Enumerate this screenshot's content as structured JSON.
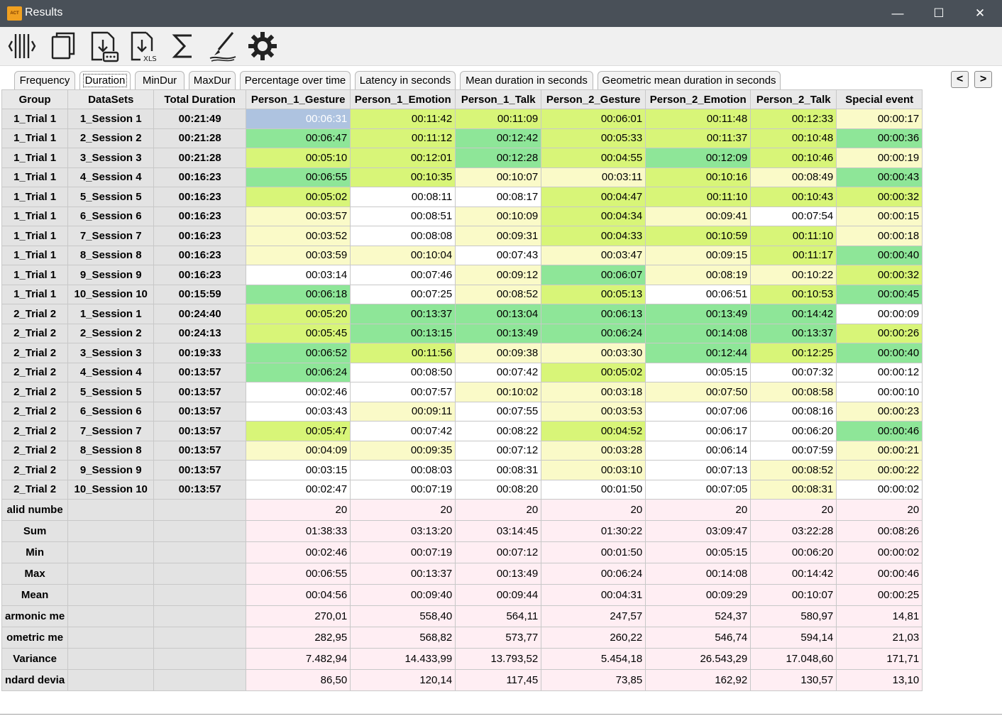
{
  "window": {
    "title": "Results",
    "app_icon_text": "ACT",
    "minimize_glyph": "—",
    "maximize_glyph": "☐",
    "close_glyph": "✕"
  },
  "toolbar": {
    "buttons": [
      "columns-icon",
      "copy-icon",
      "export-text-icon",
      "export-xls-icon",
      "sum-icon",
      "brush-icon",
      "settings-icon"
    ],
    "xls_label": "XLS"
  },
  "tabs": [
    {
      "label": "Frequency"
    },
    {
      "label": "Duration"
    },
    {
      "label": "MinDur"
    },
    {
      "label": "MaxDur"
    },
    {
      "label": "Percentage over time"
    },
    {
      "label": "Latency in seconds"
    },
    {
      "label": "Mean duration in seconds"
    },
    {
      "label": "Geometric mean duration in seconds"
    }
  ],
  "active_tab": "Duration",
  "nav": {
    "prev": "<",
    "next": ">"
  },
  "columns": [
    "Group",
    "DataSets",
    "Total Duration",
    "Person_1_Gesture",
    "Person_1_Emotion",
    "Person_1_Talk",
    "Person_2_Gesture",
    "Person_2_Emotion",
    "Person_2_Talk",
    "Special event"
  ],
  "rows": [
    {
      "group": "1_Trial 1",
      "dataset": "1_Session 1",
      "total": "00:21:49",
      "values": [
        "00:06:31",
        "00:11:42",
        "00:11:09",
        "00:06:01",
        "00:11:48",
        "00:12:33",
        "00:00:17"
      ],
      "colors": [
        "sel",
        "lime",
        "lime",
        "lime",
        "lime",
        "lime",
        "yellow"
      ]
    },
    {
      "group": "1_Trial 1",
      "dataset": "2_Session 2",
      "total": "00:21:28",
      "values": [
        "00:06:47",
        "00:11:12",
        "00:12:42",
        "00:05:33",
        "00:11:37",
        "00:10:48",
        "00:00:36"
      ],
      "colors": [
        "green",
        "lime",
        "green",
        "lime",
        "lime",
        "lime",
        "green"
      ]
    },
    {
      "group": "1_Trial 1",
      "dataset": "3_Session 3",
      "total": "00:21:28",
      "values": [
        "00:05:10",
        "00:12:01",
        "00:12:28",
        "00:04:55",
        "00:12:09",
        "00:10:46",
        "00:00:19"
      ],
      "colors": [
        "lime",
        "lime",
        "green",
        "lime",
        "green",
        "lime",
        "yellow"
      ]
    },
    {
      "group": "1_Trial 1",
      "dataset": "4_Session 4",
      "total": "00:16:23",
      "values": [
        "00:06:55",
        "00:10:35",
        "00:10:07",
        "00:03:11",
        "00:10:16",
        "00:08:49",
        "00:00:43"
      ],
      "colors": [
        "green",
        "lime",
        "yellow",
        "yellow",
        "lime",
        "yellow",
        "green"
      ]
    },
    {
      "group": "1_Trial 1",
      "dataset": "5_Session 5",
      "total": "00:16:23",
      "values": [
        "00:05:02",
        "00:08:11",
        "00:08:17",
        "00:04:47",
        "00:11:10",
        "00:10:43",
        "00:00:32"
      ],
      "colors": [
        "lime",
        "white",
        "white",
        "lime",
        "lime",
        "lime",
        "lime"
      ]
    },
    {
      "group": "1_Trial 1",
      "dataset": "6_Session 6",
      "total": "00:16:23",
      "values": [
        "00:03:57",
        "00:08:51",
        "00:10:09",
        "00:04:34",
        "00:09:41",
        "00:07:54",
        "00:00:15"
      ],
      "colors": [
        "yellow",
        "white",
        "yellow",
        "lime",
        "yellow",
        "white",
        "yellow"
      ]
    },
    {
      "group": "1_Trial 1",
      "dataset": "7_Session 7",
      "total": "00:16:23",
      "values": [
        "00:03:52",
        "00:08:08",
        "00:09:31",
        "00:04:33",
        "00:10:59",
        "00:11:10",
        "00:00:18"
      ],
      "colors": [
        "yellow",
        "white",
        "yellow",
        "lime",
        "lime",
        "lime",
        "yellow"
      ]
    },
    {
      "group": "1_Trial 1",
      "dataset": "8_Session 8",
      "total": "00:16:23",
      "values": [
        "00:03:59",
        "00:10:04",
        "00:07:43",
        "00:03:47",
        "00:09:15",
        "00:11:17",
        "00:00:40"
      ],
      "colors": [
        "yellow",
        "yellow",
        "white",
        "yellow",
        "yellow",
        "lime",
        "green"
      ]
    },
    {
      "group": "1_Trial 1",
      "dataset": "9_Session 9",
      "total": "00:16:23",
      "values": [
        "00:03:14",
        "00:07:46",
        "00:09:12",
        "00:06:07",
        "00:08:19",
        "00:10:22",
        "00:00:32"
      ],
      "colors": [
        "white",
        "white",
        "yellow",
        "green",
        "yellow",
        "yellow",
        "lime"
      ]
    },
    {
      "group": "1_Trial 1",
      "dataset": "10_Session 10",
      "total": "00:15:59",
      "values": [
        "00:06:18",
        "00:07:25",
        "00:08:52",
        "00:05:13",
        "00:06:51",
        "00:10:53",
        "00:00:45"
      ],
      "colors": [
        "green",
        "white",
        "yellow",
        "lime",
        "white",
        "lime",
        "green"
      ]
    },
    {
      "group": "2_Trial 2",
      "dataset": "1_Session 1",
      "total": "00:24:40",
      "values": [
        "00:05:20",
        "00:13:37",
        "00:13:04",
        "00:06:13",
        "00:13:49",
        "00:14:42",
        "00:00:09"
      ],
      "colors": [
        "lime",
        "green",
        "green",
        "green",
        "green",
        "green",
        "white"
      ]
    },
    {
      "group": "2_Trial 2",
      "dataset": "2_Session 2",
      "total": "00:24:13",
      "values": [
        "00:05:45",
        "00:13:15",
        "00:13:49",
        "00:06:24",
        "00:14:08",
        "00:13:37",
        "00:00:26"
      ],
      "colors": [
        "lime",
        "green",
        "green",
        "green",
        "green",
        "green",
        "lime"
      ]
    },
    {
      "group": "2_Trial 2",
      "dataset": "3_Session 3",
      "total": "00:19:33",
      "values": [
        "00:06:52",
        "00:11:56",
        "00:09:38",
        "00:03:30",
        "00:12:44",
        "00:12:25",
        "00:00:40"
      ],
      "colors": [
        "green",
        "lime",
        "yellow",
        "yellow",
        "green",
        "lime",
        "green"
      ]
    },
    {
      "group": "2_Trial 2",
      "dataset": "4_Session 4",
      "total": "00:13:57",
      "values": [
        "00:06:24",
        "00:08:50",
        "00:07:42",
        "00:05:02",
        "00:05:15",
        "00:07:32",
        "00:00:12"
      ],
      "colors": [
        "green",
        "white",
        "white",
        "lime",
        "white",
        "white",
        "white"
      ]
    },
    {
      "group": "2_Trial 2",
      "dataset": "5_Session 5",
      "total": "00:13:57",
      "values": [
        "00:02:46",
        "00:07:57",
        "00:10:02",
        "00:03:18",
        "00:07:50",
        "00:08:58",
        "00:00:10"
      ],
      "colors": [
        "white",
        "white",
        "yellow",
        "yellow",
        "yellow",
        "yellow",
        "white"
      ]
    },
    {
      "group": "2_Trial 2",
      "dataset": "6_Session 6",
      "total": "00:13:57",
      "values": [
        "00:03:43",
        "00:09:11",
        "00:07:55",
        "00:03:53",
        "00:07:06",
        "00:08:16",
        "00:00:23"
      ],
      "colors": [
        "white",
        "yellow",
        "white",
        "yellow",
        "white",
        "white",
        "yellow"
      ]
    },
    {
      "group": "2_Trial 2",
      "dataset": "7_Session 7",
      "total": "00:13:57",
      "values": [
        "00:05:47",
        "00:07:42",
        "00:08:22",
        "00:04:52",
        "00:06:17",
        "00:06:20",
        "00:00:46"
      ],
      "colors": [
        "lime",
        "white",
        "white",
        "lime",
        "white",
        "white",
        "green"
      ]
    },
    {
      "group": "2_Trial 2",
      "dataset": "8_Session 8",
      "total": "00:13:57",
      "values": [
        "00:04:09",
        "00:09:35",
        "00:07:12",
        "00:03:28",
        "00:06:14",
        "00:07:59",
        "00:00:21"
      ],
      "colors": [
        "yellow",
        "yellow",
        "white",
        "yellow",
        "white",
        "white",
        "yellow"
      ]
    },
    {
      "group": "2_Trial 2",
      "dataset": "9_Session 9",
      "total": "00:13:57",
      "values": [
        "00:03:15",
        "00:08:03",
        "00:08:31",
        "00:03:10",
        "00:07:13",
        "00:08:52",
        "00:00:22"
      ],
      "colors": [
        "white",
        "white",
        "white",
        "yellow",
        "white",
        "yellow",
        "yellow"
      ]
    },
    {
      "group": "2_Trial 2",
      "dataset": "10_Session 10",
      "total": "00:13:57",
      "values": [
        "00:02:47",
        "00:07:19",
        "00:08:20",
        "00:01:50",
        "00:07:05",
        "00:08:31",
        "00:00:02"
      ],
      "colors": [
        "white",
        "white",
        "white",
        "white",
        "white",
        "yellow",
        "white"
      ]
    }
  ],
  "stats": [
    {
      "label": "alid numbe",
      "values": [
        "20",
        "20",
        "20",
        "20",
        "20",
        "20",
        "20"
      ]
    },
    {
      "label": "Sum",
      "values": [
        "01:38:33",
        "03:13:20",
        "03:14:45",
        "01:30:22",
        "03:09:47",
        "03:22:28",
        "00:08:26"
      ]
    },
    {
      "label": "Min",
      "values": [
        "00:02:46",
        "00:07:19",
        "00:07:12",
        "00:01:50",
        "00:05:15",
        "00:06:20",
        "00:00:02"
      ]
    },
    {
      "label": "Max",
      "values": [
        "00:06:55",
        "00:13:37",
        "00:13:49",
        "00:06:24",
        "00:14:08",
        "00:14:42",
        "00:00:46"
      ]
    },
    {
      "label": "Mean",
      "values": [
        "00:04:56",
        "00:09:40",
        "00:09:44",
        "00:04:31",
        "00:09:29",
        "00:10:07",
        "00:00:25"
      ]
    },
    {
      "label": "armonic me",
      "values": [
        "270,01",
        "558,40",
        "564,11",
        "247,57",
        "524,37",
        "580,97",
        "14,81"
      ]
    },
    {
      "label": "ometric me",
      "values": [
        "282,95",
        "568,82",
        "573,77",
        "260,22",
        "546,74",
        "594,14",
        "21,03"
      ]
    },
    {
      "label": "Variance",
      "values": [
        "7.482,94",
        "14.433,99",
        "13.793,52",
        "5.454,18",
        "26.543,29",
        "17.048,60",
        "171,71"
      ]
    },
    {
      "label": "ndard devia",
      "values": [
        "86,50",
        "120,14",
        "117,45",
        "73,85",
        "162,92",
        "130,57",
        "13,10"
      ]
    }
  ],
  "colors": {
    "titlebar": "#495058",
    "white": "#ffffff",
    "yellow": "#fafac8",
    "lime": "#d8f578",
    "green": "#8ee698",
    "selected": "#aec3e0",
    "stats_bg": "#ffeef3",
    "header_bg": "#e8e8e8"
  }
}
